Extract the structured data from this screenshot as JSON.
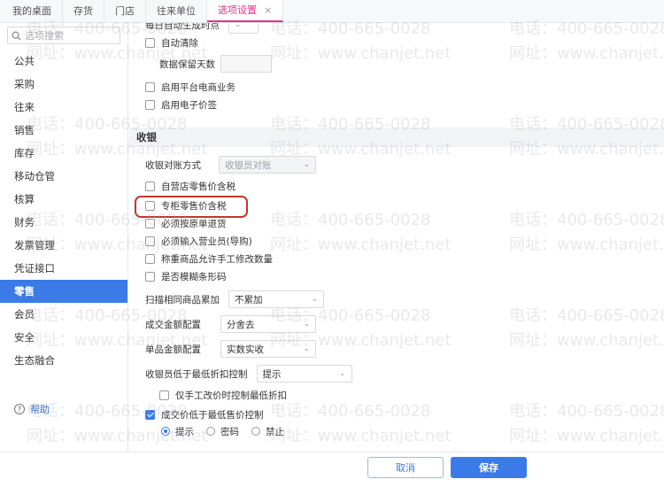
{
  "tabs": [
    {
      "label": "我的桌面"
    },
    {
      "label": "存货"
    },
    {
      "label": "门店"
    },
    {
      "label": "往来单位"
    },
    {
      "label": "选项设置",
      "active": true
    }
  ],
  "tab_close": "×",
  "sidebar": {
    "search_placeholder": "选项搜索",
    "items": [
      "公共",
      "采购",
      "往来",
      "销售",
      "库存",
      "移动仓管",
      "核算",
      "财务",
      "发票管理",
      "凭证接口",
      "零售",
      "会员",
      "安全",
      "生态融合"
    ],
    "active_index": 10,
    "help": "帮助"
  },
  "options": {
    "top_partial": "每日自动生成时点",
    "auto_clear": "自动清除",
    "retention_days": "数据保留天数",
    "platform_ecommerce": "启用平台电商业务",
    "e_price_tag": "启用电子价签"
  },
  "cashier": {
    "section_title": "收银",
    "reconcile_label": "收银对账方式",
    "reconcile_value": "收银员对账",
    "self_store_tax": "自营店零售价含税",
    "counter_tax": "专柜零售价含税",
    "must_return_by_bill": "必须按原单退货",
    "must_input_salesman": "必须输入营业员(导购)",
    "weigh_manual_qty": "称重商品允许手工修改数量",
    "fuzzy_barcode": "是否模糊条形码",
    "scan_label": "扫描相同商品累加",
    "scan_value": "不累加",
    "amount_label": "成交金额配置",
    "amount_value": "分舍去",
    "unit_label": "单品金额配置",
    "unit_value": "实数实收",
    "discount_label": "收银员低于最低折扣控制",
    "discount_value": "提示",
    "manual_price_only": "仅手工改价时控制最低折扣",
    "below_min_price": "成交价低于最低售价控制",
    "radio_options": [
      "提示",
      "密码",
      "禁止"
    ],
    "radio_selected": 0
  },
  "footer": {
    "cancel": "取消",
    "save": "保存"
  },
  "watermark": {
    "phone": "电话：400-665-0028",
    "site": "网址：www.chanjet.net"
  },
  "colors": {
    "accent": "#3b7be8",
    "active_tab": "#e0338b",
    "highlight": "#c0392b"
  }
}
